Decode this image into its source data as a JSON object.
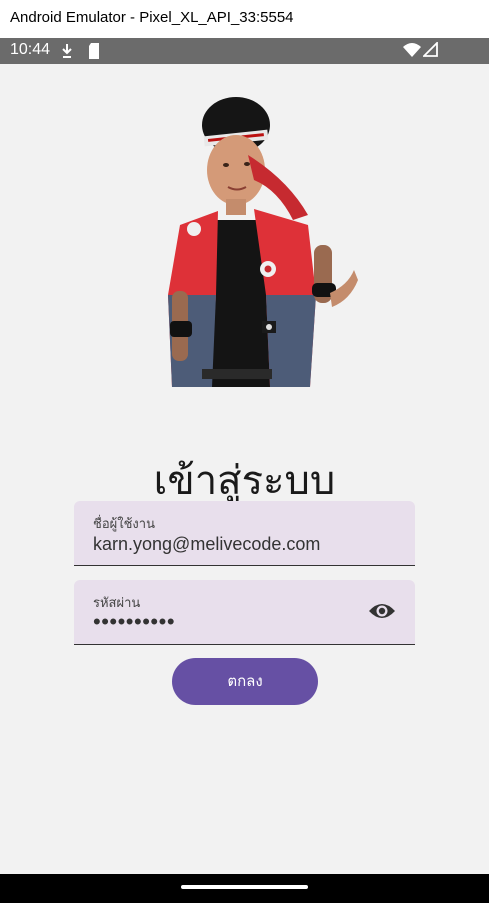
{
  "window": {
    "title": "Android Emulator - Pixel_XL_API_33:5554"
  },
  "status_bar": {
    "time": "10:44"
  },
  "login": {
    "heading": "เข้าสู่ระบบ",
    "username": {
      "label": "ชื่อผู้ใช้งาน",
      "value": "karn.yong@melivecode.com"
    },
    "password": {
      "label": "รหัสผ่าน",
      "value": "••••••••••"
    },
    "submit_label": "ตกลง"
  },
  "colors": {
    "primary": "#6650a4",
    "field_bg": "#e8dfec",
    "screen_bg": "#f2f2f2"
  }
}
